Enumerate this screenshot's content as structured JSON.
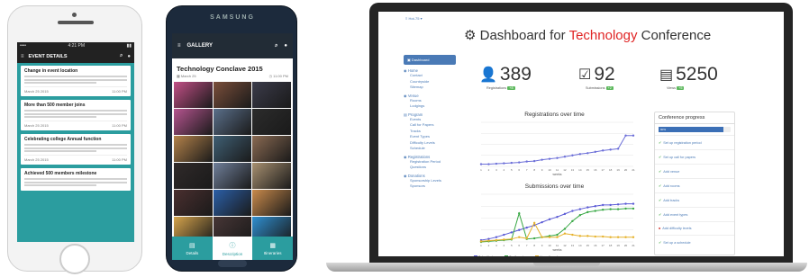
{
  "iphone": {
    "status": {
      "carrier": "•••• ",
      "time": "4:21 PM",
      "battery": "▮▮"
    },
    "title": "EVENT DETAILS",
    "cards": [
      {
        "title": "Change in event location",
        "date": "March 25 2015",
        "time": "11:00 PM"
      },
      {
        "title": "More than 500 member joins",
        "date": "March 25 2015",
        "time": "11:00 PM"
      },
      {
        "title": "Celebrating college Annual function",
        "date": "March 25 2015",
        "time": "11:00 PM"
      },
      {
        "title": "Achieved 500 members milestone",
        "date": "",
        "time": ""
      }
    ]
  },
  "samsung": {
    "brand": "SAMSUNG",
    "title": "GALLERY",
    "album_title": "Technology Conclave 2015",
    "album_date": "March 25",
    "album_time": "11:00 PM",
    "photo_colors": [
      "#c24f86",
      "#7a4e3a",
      "#3b3b4a",
      "#b5548f",
      "#5a6f8a",
      "#2c2c2c",
      "#b4824a",
      "#3f5f74",
      "#8a6a52",
      "#302a2a",
      "#6f7f9a",
      "#a89070",
      "#4a2f2f",
      "#2b5fa8",
      "#c98a4b",
      "#d6a44c",
      "#473636",
      "#2f8fd0"
    ],
    "tabs": [
      {
        "label": "Details",
        "icon": "▤"
      },
      {
        "label": "Description",
        "icon": "ⓘ"
      },
      {
        "label": "Itineraries",
        "icon": "▦"
      }
    ]
  },
  "laptop": {
    "topnav": "≡ Hot-75 ▾",
    "title_pre": "Dashboard for ",
    "title_hl": "Technology",
    "title_post": " Conference",
    "sidebar": {
      "active": "▣ Dashboard",
      "sections": [
        {
          "label": "◉ Home",
          "items": [
            "Contact",
            "Countryside",
            "Sitemap"
          ]
        },
        {
          "label": "◉ Venue",
          "items": [
            "Rooms",
            "Lodgings"
          ]
        },
        {
          "label": "▤ Program",
          "items": [
            "Events",
            "Call for Papers",
            "Tracks",
            "Event Types",
            "Difficulty Levels",
            "Schedule"
          ]
        },
        {
          "label": "◉ Registrations",
          "items": [
            "Registration Period",
            "Questions"
          ]
        },
        {
          "label": "◉ Donations",
          "items": [
            "Sponsorship Levels",
            "Sponsors"
          ]
        }
      ]
    },
    "stats": [
      {
        "icon": "👤",
        "value": "389",
        "label": "Registrations",
        "badge": "+8"
      },
      {
        "icon": "☑",
        "value": "92",
        "label": "Submissions",
        "badge": "+2"
      },
      {
        "icon": "▤",
        "value": "5250",
        "label": "Views",
        "badge": "+5"
      }
    ],
    "progress": {
      "title": "Conference progress",
      "percent": 0.9,
      "percent_label": "90%",
      "tasks": [
        {
          "label": "Set up registration period",
          "done": true
        },
        {
          "label": "Set up call for papers",
          "done": true
        },
        {
          "label": "Add venue",
          "done": true
        },
        {
          "label": "Add rooms",
          "done": true
        },
        {
          "label": "Add tracks",
          "done": true
        },
        {
          "label": "Add event types",
          "done": true
        },
        {
          "label": "Add difficulty levels",
          "done": false
        },
        {
          "label": "Set up a schedule",
          "done": true
        }
      ]
    }
  },
  "chart_data": [
    {
      "type": "line",
      "title": "Registrations over time",
      "xlabel": "weeks",
      "x": [
        1,
        2,
        3,
        4,
        5,
        6,
        7,
        8,
        9,
        10,
        11,
        12,
        13,
        14,
        15,
        16,
        17,
        18,
        19,
        20,
        21
      ],
      "ylim": [
        0,
        100
      ],
      "series": [
        {
          "color": "#6c6fd8",
          "values": [
            5,
            5,
            6,
            7,
            8,
            9,
            11,
            12,
            15,
            17,
            19,
            22,
            25,
            28,
            30,
            33,
            36,
            38,
            40,
            70,
            70
          ]
        }
      ]
    },
    {
      "type": "line",
      "title": "Submissions over time",
      "xlabel": "weeks",
      "x": [
        1,
        2,
        3,
        4,
        5,
        6,
        7,
        8,
        9,
        10,
        11,
        12,
        13,
        14,
        15,
        16,
        17,
        18,
        19,
        20,
        21
      ],
      "ylim": [
        0,
        80
      ],
      "series": [
        {
          "name": "Submitted",
          "color": "#5b5bd6",
          "values": [
            3,
            5,
            8,
            12,
            16,
            20,
            24,
            28,
            33,
            38,
            42,
            47,
            52,
            55,
            58,
            60,
            62,
            62,
            63,
            64,
            64
          ]
        },
        {
          "name": "Confirmed",
          "color": "#39a845",
          "values": [
            0,
            1,
            2,
            3,
            4,
            48,
            5,
            6,
            8,
            10,
            12,
            22,
            35,
            45,
            50,
            52,
            54,
            55,
            55,
            56,
            56
          ]
        },
        {
          "name": "Unconfirmed",
          "color": "#e6b22c",
          "values": [
            1,
            2,
            3,
            4,
            5,
            8,
            6,
            32,
            8,
            8,
            8,
            14,
            12,
            10,
            10,
            9,
            9,
            8,
            8,
            8,
            8
          ]
        }
      ]
    }
  ]
}
